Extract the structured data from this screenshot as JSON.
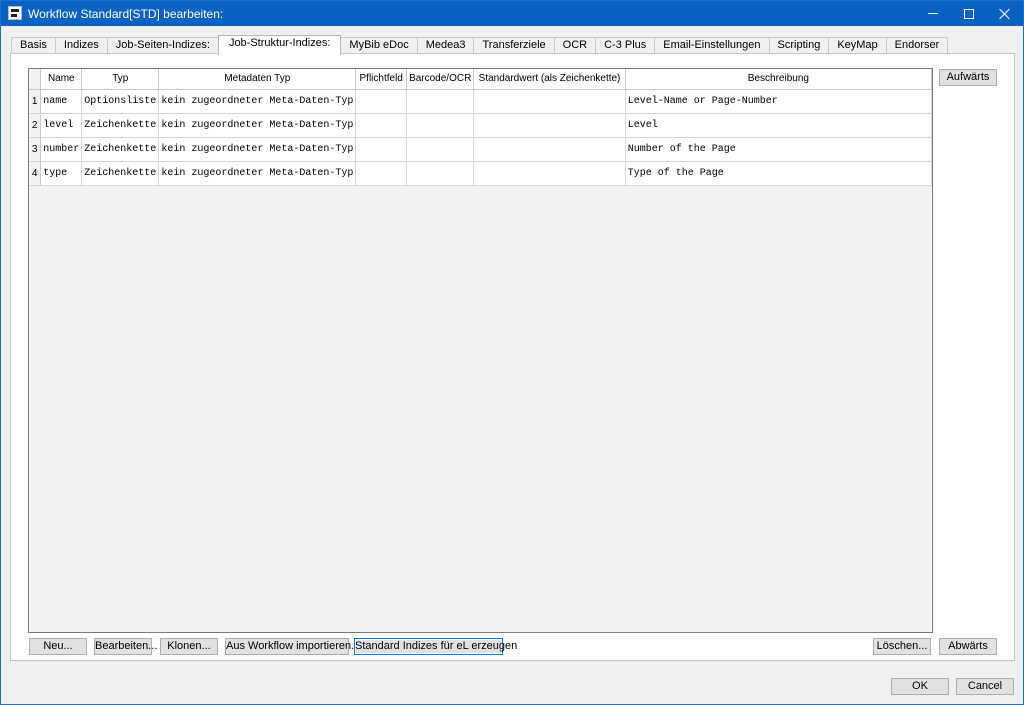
{
  "window": {
    "title": "Workflow Standard[STD] bearbeiten:"
  },
  "tabs": [
    {
      "label": "Basis"
    },
    {
      "label": "Indizes"
    },
    {
      "label": "Job-Seiten-Indizes:"
    },
    {
      "label": "Job-Struktur-Indizes:",
      "active": true
    },
    {
      "label": "MyBib eDoc"
    },
    {
      "label": "Medea3"
    },
    {
      "label": "Transferziele"
    },
    {
      "label": "OCR"
    },
    {
      "label": "C-3 Plus"
    },
    {
      "label": "Email-Einstellungen"
    },
    {
      "label": "Scripting"
    },
    {
      "label": "KeyMap"
    },
    {
      "label": "Endorser"
    }
  ],
  "table": {
    "columns": [
      "Name",
      "Typ",
      "Metadaten Typ",
      "Pflichtfeld",
      "Barcode/OCR",
      "Standardwert (als Zeichenkette)",
      "Beschreibung"
    ],
    "rows": [
      {
        "num": "1",
        "name": "name",
        "typ": "Optionsliste",
        "meta": "kein zugeordneter Meta-Daten-Typ",
        "pflicht": "",
        "barcode": "",
        "standard": "",
        "beschreibung": "Level-Name or Page-Number"
      },
      {
        "num": "2",
        "name": "level",
        "typ": "Zeichenkette",
        "meta": "kein zugeordneter Meta-Daten-Typ",
        "pflicht": "",
        "barcode": "",
        "standard": "",
        "beschreibung": "Level"
      },
      {
        "num": "3",
        "name": "number",
        "typ": "Zeichenkette",
        "meta": "kein zugeordneter Meta-Daten-Typ",
        "pflicht": "",
        "barcode": "",
        "standard": "",
        "beschreibung": "Number of the Page"
      },
      {
        "num": "4",
        "name": "type",
        "typ": "Zeichenkette",
        "meta": "kein zugeordneter Meta-Daten-Typ",
        "pflicht": "",
        "barcode": "",
        "standard": "",
        "beschreibung": "Type of the Page"
      }
    ]
  },
  "side_buttons": {
    "up": "Aufwärts",
    "down": "Abwärts",
    "delete": "Löschen..."
  },
  "bottom_buttons": {
    "new": "Neu...",
    "edit": "Bearbeiten...",
    "clone": "Klonen...",
    "import": "Aus Workflow importieren...",
    "standard": "Standard Indizes für eL erzeugen"
  },
  "dialog_buttons": {
    "ok": "OK",
    "cancel": "Cancel"
  },
  "colors": {
    "titlebar": "#0a63c3",
    "focus": "#0078d7"
  }
}
